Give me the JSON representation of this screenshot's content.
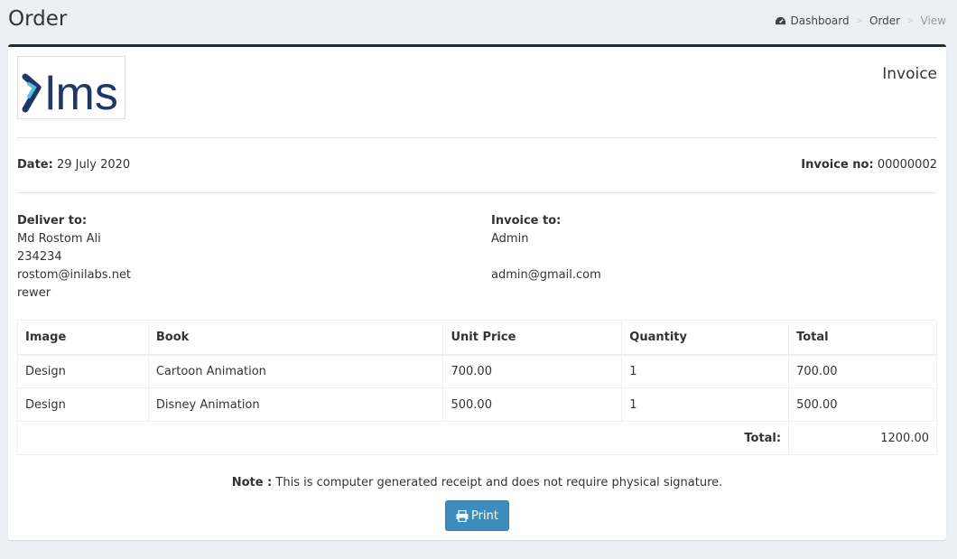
{
  "header": {
    "title": "Order",
    "breadcrumb": {
      "dashboard": "Dashboard",
      "order": "Order",
      "view": "View"
    }
  },
  "invoice": {
    "logo_text": "lms",
    "title": "Invoice",
    "date_label": "Date:",
    "date_value": "29 July 2020",
    "invoice_no_label": "Invoice no:",
    "invoice_no_value": "00000002",
    "deliver_to": {
      "label": "Deliver to:",
      "lines": [
        "Md Rostom Ali",
        "234234",
        "rostom@inilabs.net",
        "rewer"
      ]
    },
    "invoice_to": {
      "label": "Invoice to:",
      "lines": [
        "Admin",
        "",
        "admin@gmail.com"
      ]
    }
  },
  "table": {
    "headers": [
      "Image",
      "Book",
      "Unit Price",
      "Quantity",
      "Total"
    ],
    "rows": [
      [
        "Design",
        "Cartoon Animation",
        "700.00",
        "1",
        "700.00"
      ],
      [
        "Design",
        "Disney Animation",
        "500.00",
        "1",
        "500.00"
      ]
    ],
    "total_label": "Total:",
    "total_value": "1200.00"
  },
  "note": {
    "label": "Note :",
    "text": "This is computer generated receipt and does not require physical signature."
  },
  "print_label": "Print",
  "colors": {
    "primary": "#3c8dbc",
    "box_border": "#222d32",
    "logo_dark": "#1f3768",
    "logo_light": "#5bc0de"
  }
}
